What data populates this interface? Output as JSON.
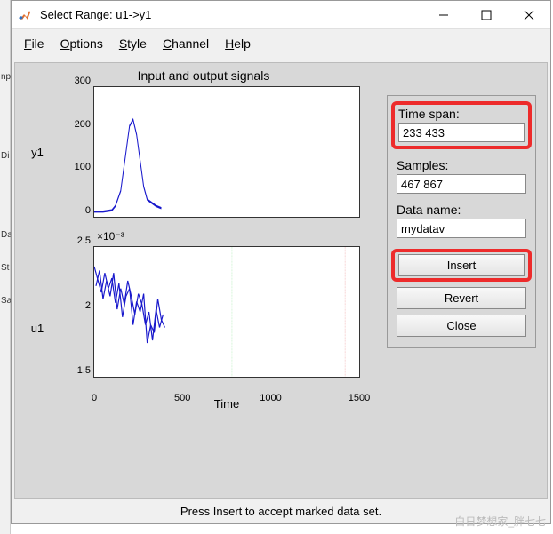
{
  "left_strip": {
    "l1": "np",
    "l2": "Di",
    "l3": "Da",
    "l4": "St",
    "l5": "Sa"
  },
  "titlebar": {
    "title": "Select Range: u1->y1"
  },
  "menu": {
    "file": "File",
    "options": "Options",
    "style": "Style",
    "channel": "Channel",
    "help": "Help"
  },
  "chart_title": "Input and output signals",
  "chart1": {
    "ylabel": "y1",
    "yticks": {
      "t0": "0",
      "t1": "100",
      "t2": "200",
      "t3": "300"
    }
  },
  "chart2": {
    "ylabel": "u1",
    "expo": "×10⁻³",
    "yticks": {
      "t0": "1.5",
      "t1": "2",
      "t2": "2.5"
    },
    "xticks": {
      "t0": "0",
      "t1": "500",
      "t2": "1000",
      "t3": "1500"
    },
    "xlabel": "Time"
  },
  "panel": {
    "timespan_label": "Time span:",
    "timespan_value": "233 433",
    "samples_label": "Samples:",
    "samples_value": "467 867",
    "dataname_label": "Data name:",
    "dataname_value": "mydatav",
    "insert": "Insert",
    "revert": "Revert",
    "close": "Close"
  },
  "statusbar": {
    "text": "Press Insert to accept marked data set."
  },
  "watermark": "白日梦想家_胖七七",
  "chart_data": [
    {
      "type": "line",
      "title": "y1",
      "xlim": [
        0,
        1500
      ],
      "ylim": [
        0,
        300
      ],
      "series": [
        {
          "name": "y1",
          "color": "#1818cc",
          "x": [
            0,
            50,
            100,
            120,
            150,
            180,
            200,
            220,
            240,
            260,
            280,
            300,
            350,
            380
          ],
          "y": [
            12,
            12,
            15,
            25,
            60,
            150,
            210,
            225,
            190,
            130,
            70,
            40,
            25,
            20
          ]
        }
      ]
    },
    {
      "type": "line",
      "title": "u1",
      "xlim": [
        0,
        1500
      ],
      "ylim": [
        0.0015,
        0.0025
      ],
      "xlabel": "Time",
      "annotations": [
        {
          "kind": "vline",
          "x": 780,
          "style": "dashed",
          "color": "green"
        },
        {
          "kind": "vline",
          "x": 1420,
          "style": "dashed",
          "color": "red"
        }
      ],
      "series": [
        {
          "name": "u1",
          "color": "#1818cc",
          "x": [
            0,
            20,
            40,
            60,
            80,
            100,
            120,
            140,
            160,
            180,
            200,
            220,
            240,
            260,
            280,
            300,
            320,
            340,
            360,
            380,
            400
          ],
          "y": [
            0.00235,
            0.00225,
            0.00215,
            0.0023,
            0.00218,
            0.00226,
            0.00207,
            0.00222,
            0.00196,
            0.00212,
            0.00218,
            0.0019,
            0.00208,
            0.002,
            0.00214,
            0.00176,
            0.0019,
            0.00184,
            0.0021,
            0.00194,
            0.00188
          ]
        }
      ]
    }
  ]
}
